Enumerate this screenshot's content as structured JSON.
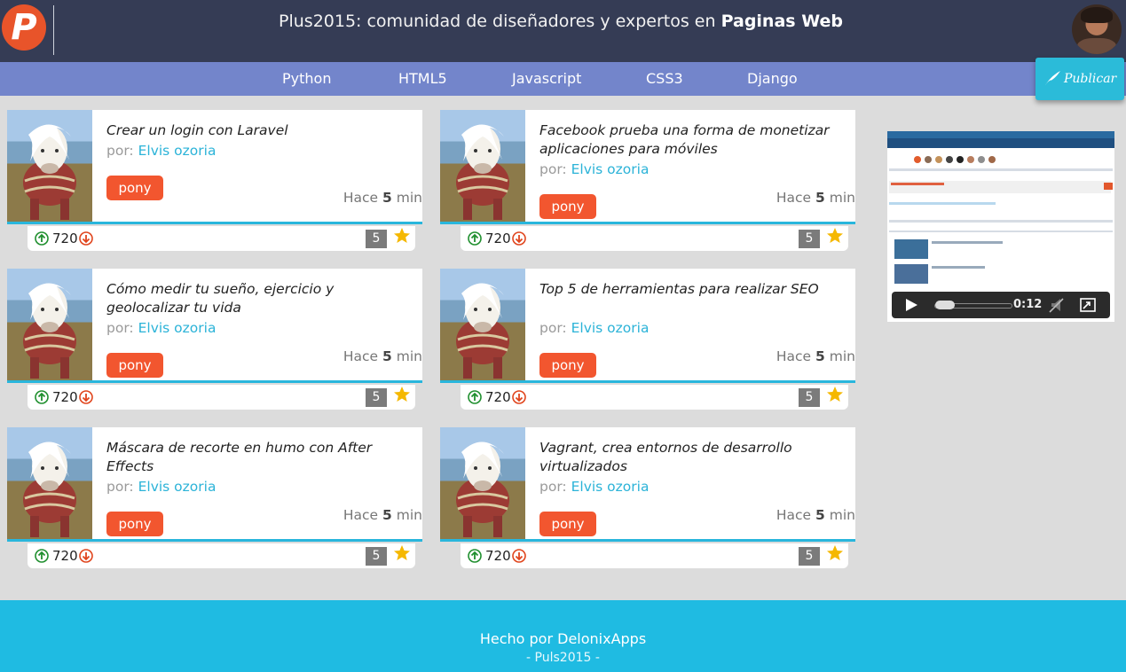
{
  "header": {
    "title_prefix": "Plus2015: comunidad de diseñadores y expertos en",
    "title_bold": "Paginas Web",
    "logo_letter": "P"
  },
  "nav": {
    "items": [
      "Python",
      "HTML5",
      "Javascript",
      "CSS3",
      "Django"
    ],
    "publish_label": "Publicar"
  },
  "posts": [
    {
      "title": "Crear un login con Laravel",
      "author_prefix": "por:",
      "author": "Elvis ozoria",
      "tag": "pony",
      "time_prefix": "Hace",
      "time_value": "5",
      "time_unit": "min",
      "votes": "720",
      "comments": "5"
    },
    {
      "title": "Facebook prueba una forma de monetizar aplicaciones para móviles",
      "author_prefix": "por:",
      "author": "Elvis ozoria",
      "tag": "pony",
      "time_prefix": "Hace",
      "time_value": "5",
      "time_unit": "min",
      "votes": "720",
      "comments": "5"
    },
    {
      "title": "Cómo medir tu sueño, ejercicio y geolocalizar tu vida",
      "author_prefix": "por:",
      "author": "Elvis ozoria",
      "tag": "pony",
      "time_prefix": "Hace",
      "time_value": "5",
      "time_unit": "min",
      "votes": "720",
      "comments": "5"
    },
    {
      "title": "Top 5 de herramientas para realizar SEO",
      "author_prefix": "por:",
      "author": "Elvis ozoria",
      "tag": "pony",
      "time_prefix": "Hace",
      "time_value": "5",
      "time_unit": "min",
      "votes": "720",
      "comments": "5"
    },
    {
      "title": "Máscara de recorte en humo con After Effects",
      "author_prefix": "por:",
      "author": "Elvis ozoria",
      "tag": "pony",
      "time_prefix": "Hace",
      "time_value": "5",
      "time_unit": "min",
      "votes": "720",
      "comments": "5"
    },
    {
      "title": "Vagrant, crea entornos de desarrollo virtualizados",
      "author_prefix": "por:",
      "author": "Elvis ozoria",
      "tag": "pony",
      "time_prefix": "Hace",
      "time_value": "5",
      "time_unit": "min",
      "votes": "720",
      "comments": "5"
    }
  ],
  "video": {
    "time": "0:12",
    "progress": 0.05
  },
  "footer": {
    "line1": "Hecho por DelonixApps",
    "line2": "- Puls2015 -"
  },
  "colors": {
    "header_bg": "#353c55",
    "nav_bg": "#7385cb",
    "accent": "#29b6dc",
    "tag_bg": "#f2562f",
    "footer_bg": "#1fbbe2",
    "page_bg": "#dcdcdc"
  },
  "icons": {
    "upvote": "arrow-up-circle-icon",
    "downvote": "arrow-down-circle-icon",
    "favorite": "star-icon",
    "publish": "quill-icon",
    "play": "play-icon",
    "mute": "mute-icon",
    "fullscreen": "fullscreen-icon"
  }
}
